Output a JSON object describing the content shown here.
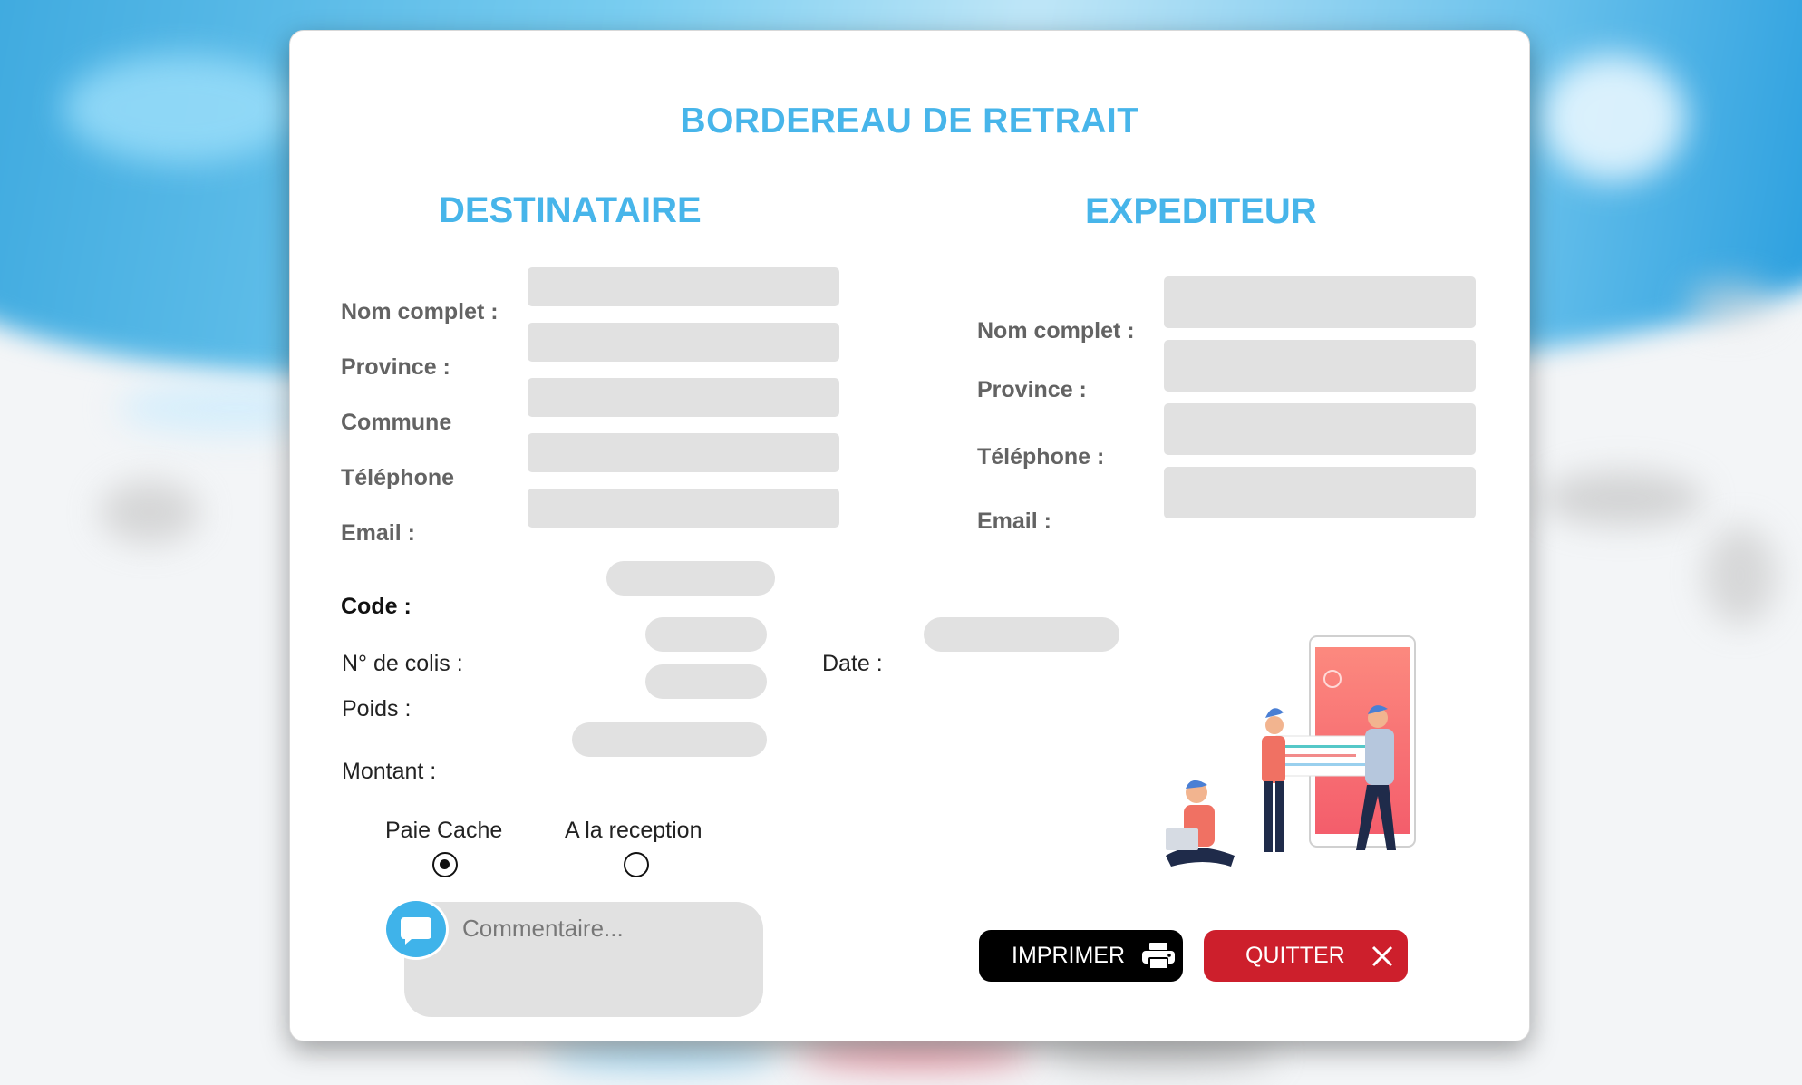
{
  "modal": {
    "title": "BORDEREAU DE RETRAIT",
    "destinataire": {
      "heading": "DESTINATAIRE",
      "fields": [
        {
          "label": "Nom complet :",
          "value": ""
        },
        {
          "label": "Province :",
          "value": ""
        },
        {
          "label": "Commune",
          "value": ""
        },
        {
          "label": "Téléphone",
          "value": ""
        },
        {
          "label": "Email :",
          "value": ""
        }
      ]
    },
    "expediteur": {
      "heading": "EXPEDITEUR",
      "fields": [
        {
          "label": "Nom complet :",
          "value": ""
        },
        {
          "label": "Province :",
          "value": ""
        },
        {
          "label": "Téléphone :",
          "value": ""
        },
        {
          "label": "Email :",
          "value": ""
        }
      ]
    },
    "code": {
      "label": "Code :",
      "value": ""
    },
    "colis": {
      "label": "N° de colis :",
      "value": ""
    },
    "date": {
      "label": "Date :",
      "value": ""
    },
    "poids": {
      "label": "Poids :",
      "value": ""
    },
    "montant": {
      "label": "Montant :",
      "value": ""
    },
    "payment": {
      "options": [
        {
          "label": "Paie Cache",
          "selected": true
        },
        {
          "label": "A la reception",
          "selected": false
        }
      ]
    },
    "comment": {
      "placeholder": "Commentaire...",
      "value": ""
    },
    "buttons": {
      "print_label": "IMPRIMER",
      "print_icon": "printer-icon",
      "quit_label": "QUITTER",
      "quit_icon": "close-icon"
    },
    "colors": {
      "accent": "#47b5ea",
      "print_button": "#000000",
      "quit_button": "#cd1f2c",
      "field": "#e1e1e1"
    }
  }
}
